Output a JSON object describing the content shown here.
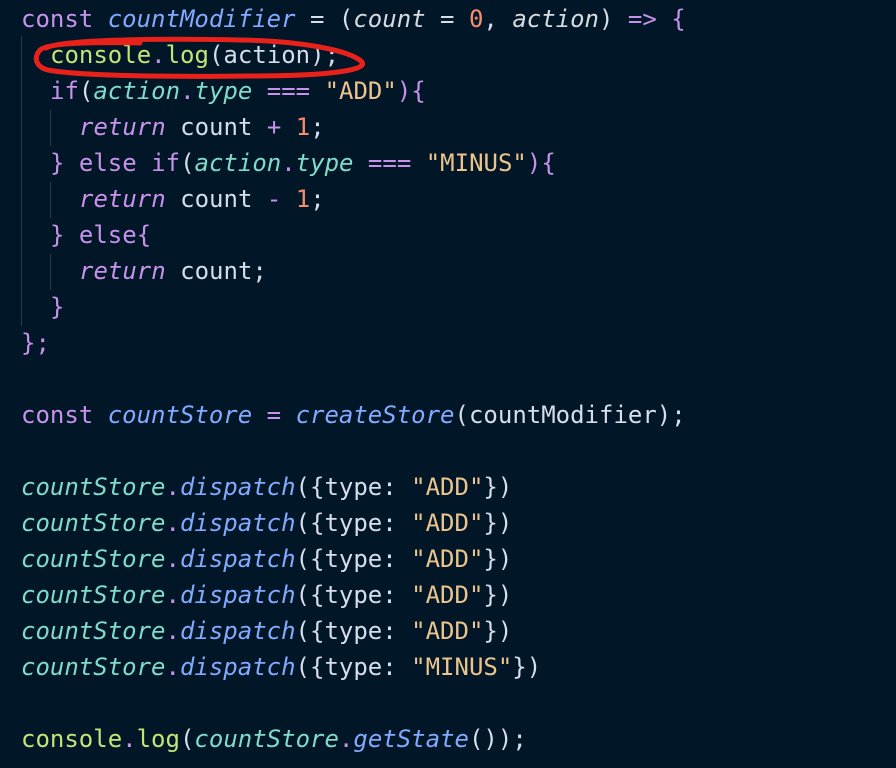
{
  "code": {
    "l1": {
      "kw_const": "const",
      "name": "countModifier",
      "eq": " = (",
      "p1": "count",
      "eq2": " = ",
      "zero": "0",
      "comma": ", ",
      "p2": "action",
      "arrow_close": ") ",
      "arrow": "=>",
      "brace": " {"
    },
    "l2": {
      "obj": "console",
      "dot": ".",
      "method": "log",
      "args": "(action);"
    },
    "l3": {
      "kw": "if",
      "open": "(",
      "obj": "action",
      "dot": ".",
      "prop": "type",
      "op": " === ",
      "str": "\"ADD\"",
      "close": "){"
    },
    "l4": {
      "kw": "return",
      "rest": " count ",
      "op": "+",
      "num": " 1",
      "semi": ";"
    },
    "l5": {
      "close": "} ",
      "kw_else": "else ",
      "kw_if": "if",
      "open": "(",
      "obj": "action",
      "dot": ".",
      "prop": "type",
      "op": " === ",
      "str": "\"MINUS\"",
      "close2": "){"
    },
    "l6": {
      "kw": "return",
      "rest": " count ",
      "op": "-",
      "num": " 1",
      "semi": ";"
    },
    "l7": {
      "close": "} ",
      "kw_else": "else",
      "brace": "{"
    },
    "l8": {
      "kw": "return",
      "rest": " count;"
    },
    "l9": {
      "brace": "}"
    },
    "l10": {
      "text": "};"
    },
    "l12": {
      "kw_const": "const",
      "name": "countStore",
      "eq": " = ",
      "fn": "createStore",
      "args": "(countModifier);"
    },
    "dispatches": [
      {
        "obj": "countStore",
        "dot": ".",
        "method": "dispatch",
        "open": "({type: ",
        "str": "\"ADD\"",
        "close": "})"
      },
      {
        "obj": "countStore",
        "dot": ".",
        "method": "dispatch",
        "open": "({type: ",
        "str": "\"ADD\"",
        "close": "})"
      },
      {
        "obj": "countStore",
        "dot": ".",
        "method": "dispatch",
        "open": "({type: ",
        "str": "\"ADD\"",
        "close": "})"
      },
      {
        "obj": "countStore",
        "dot": ".",
        "method": "dispatch",
        "open": "({type: ",
        "str": "\"ADD\"",
        "close": "})"
      },
      {
        "obj": "countStore",
        "dot": ".",
        "method": "dispatch",
        "open": "({type: ",
        "str": "\"ADD\"",
        "close": "})"
      },
      {
        "obj": "countStore",
        "dot": ".",
        "method": "dispatch",
        "open": "({type: ",
        "str": "\"MINUS\"",
        "close": "})"
      }
    ],
    "l21": {
      "obj": "console",
      "dot": ".",
      "method": "log",
      "open": "(",
      "obj2": "countStore",
      "dot2": ".",
      "method2": "getState",
      "close": "());"
    }
  },
  "colors": {
    "background": "#011627",
    "annotation": "#e8221b"
  }
}
